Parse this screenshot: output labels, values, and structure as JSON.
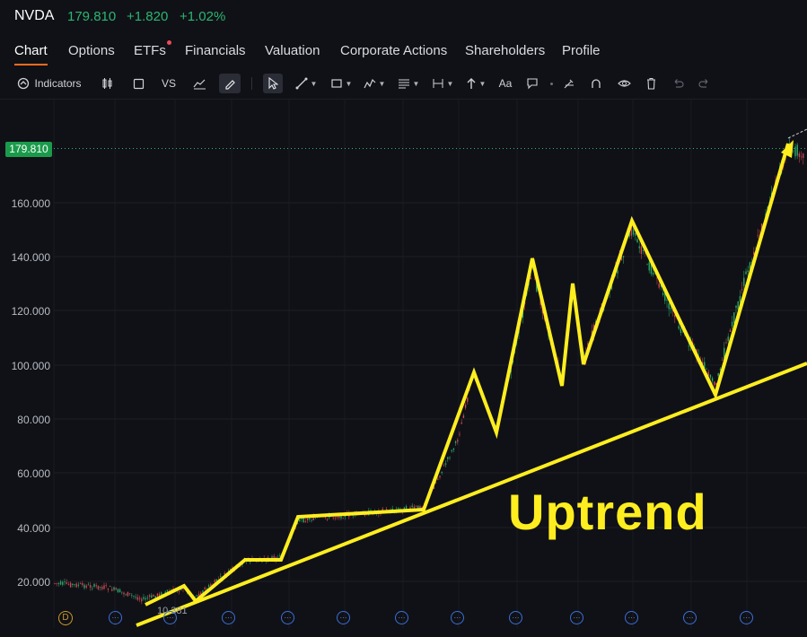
{
  "header": {
    "ticker": "NVDA",
    "price": "179.810",
    "change": "+1.820",
    "change_pct": "+1.02%"
  },
  "tabs": [
    {
      "label": "Chart"
    },
    {
      "label": "Options"
    },
    {
      "label": "ETFs"
    },
    {
      "label": "Financials"
    },
    {
      "label": "Valuation"
    },
    {
      "label": "Corporate Actions"
    },
    {
      "label": "Shareholders"
    },
    {
      "label": "Profile"
    }
  ],
  "toolbar": {
    "indicators_label": "Indicators",
    "vs_label": "VS",
    "text_tool_label": "Aa"
  },
  "chart": {
    "current_price_tag": "179.810",
    "y_ticks": [
      "160.000",
      "140.000",
      "120.000",
      "100.000",
      "80.000",
      "60.000",
      "40.000",
      "20.000"
    ],
    "annotation_text": "Uptrend",
    "low_label": "10.381",
    "footer_marker": "D",
    "footer_event": "···",
    "colors": {
      "up": "#2bb673",
      "down": "#e04b5a",
      "annotation": "#ffee1f",
      "price_tag": "#1a9b4b",
      "accent": "#ff6a1f"
    }
  }
}
